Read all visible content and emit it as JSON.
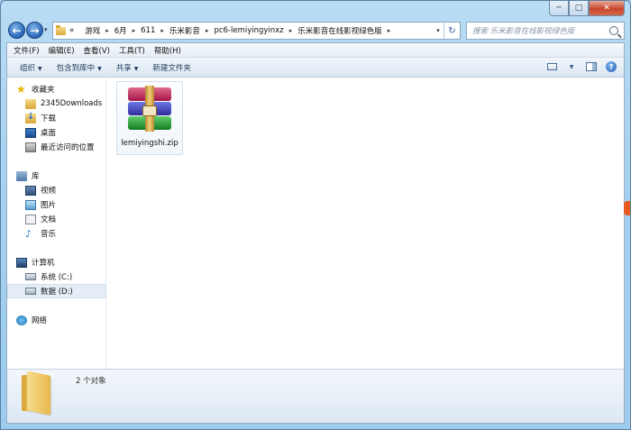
{
  "window": {
    "minimize_glyph": "─",
    "maximize_glyph": "□",
    "close_glyph": "✕"
  },
  "nav": {
    "back_glyph": "←",
    "forward_glyph": "→",
    "dropdown_glyph": "▾"
  },
  "address": {
    "overflow": "«",
    "crumbs": [
      "游戏",
      "6月",
      "611",
      "乐米影音",
      "pc6-lemiyingyinxz",
      "乐米影音在线影视绿色版"
    ],
    "separator": "▸",
    "refresh_glyph": "↻"
  },
  "search": {
    "placeholder": "搜索 乐米影音在线影视绿色版"
  },
  "menu": [
    "文件(F)",
    "编辑(E)",
    "查看(V)",
    "工具(T)",
    "帮助(H)"
  ],
  "toolbar": {
    "organize": "组织",
    "include_library": "包含到库中",
    "share": "共享",
    "new_folder": "新建文件夹",
    "help_glyph": "?"
  },
  "sidebar": {
    "favorites": "收藏夹",
    "favorites_items": [
      "2345Downloads",
      "下载",
      "桌面",
      "最近访问的位置"
    ],
    "libraries": "库",
    "library_items": [
      "视频",
      "图片",
      "文档",
      "音乐"
    ],
    "computer": "计算机",
    "drives": [
      "系统 (C:)",
      "数据 (D:)"
    ],
    "network": "网络"
  },
  "files": [
    {
      "name": "lemiyingshi.zip",
      "icon": "winrar-archive-icon"
    }
  ],
  "details": {
    "count": "2 个对象"
  },
  "colors": {
    "window_frame": "#a6d1ef",
    "selection": "#e5eef7",
    "side_tab": "#e8581f"
  }
}
